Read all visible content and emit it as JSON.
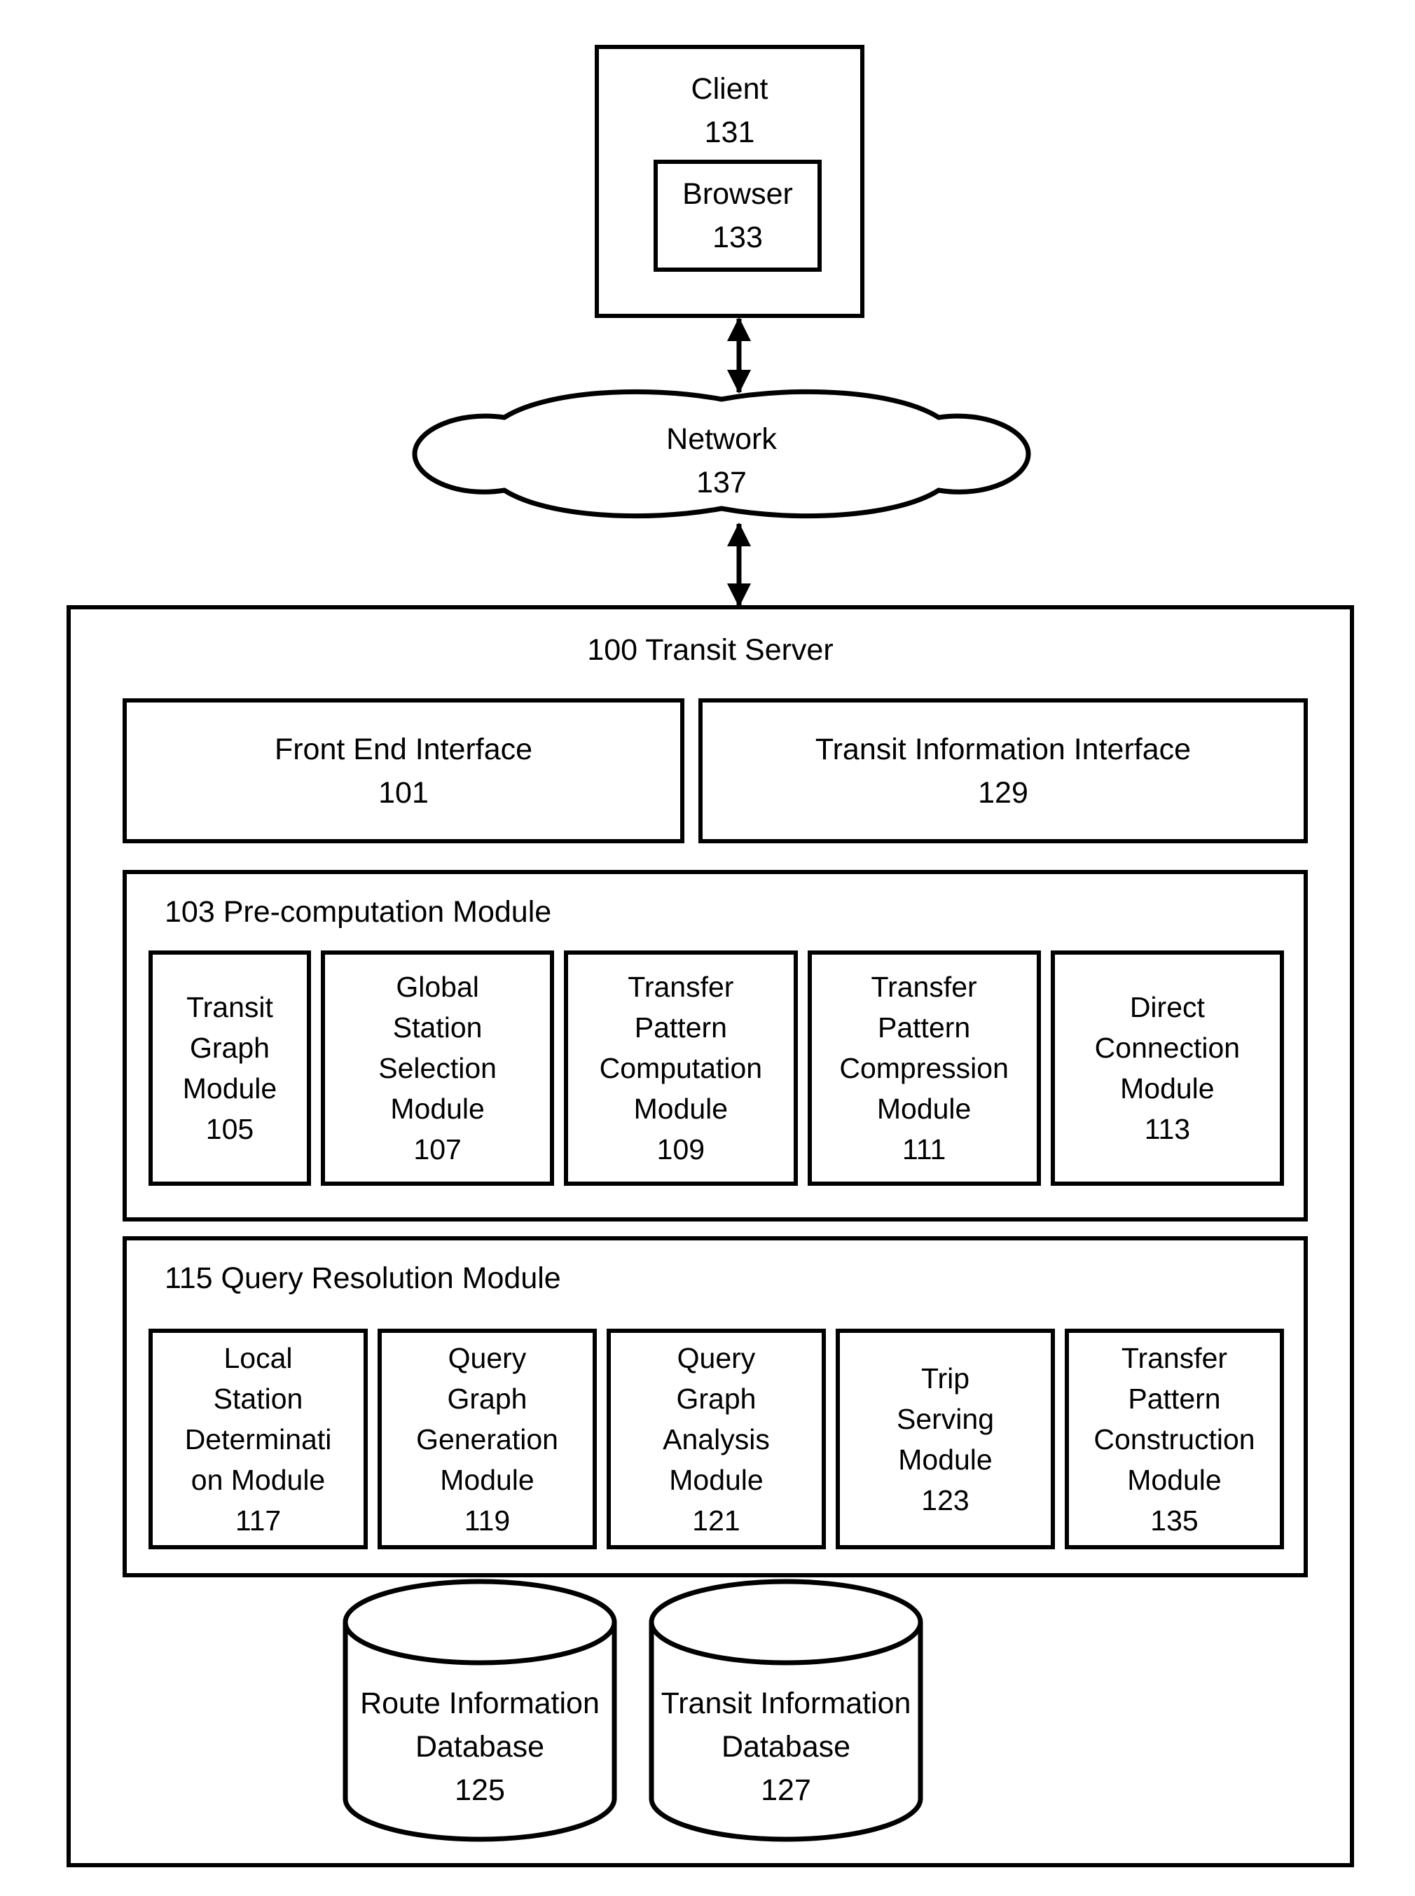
{
  "client": {
    "title": "Client\n131",
    "browser": {
      "title": "Browser\n133"
    }
  },
  "network": {
    "label": "Network\n137"
  },
  "arrows": {
    "client_to_network": "bidirectional-arrow",
    "network_to_server": "bidirectional-arrow"
  },
  "server": {
    "title": "100 Transit Server",
    "interfaces": [
      {
        "label": "Front End Interface\n101"
      },
      {
        "label": "Transit Information Interface\n129"
      }
    ],
    "precomputation": {
      "title": "103 Pre-computation Module",
      "modules": [
        {
          "label": "Transit\nGraph\nModule\n105"
        },
        {
          "label": "Global\nStation\nSelection\nModule\n107"
        },
        {
          "label": "Transfer\nPattern\nComputation\nModule\n109"
        },
        {
          "label": "Transfer\nPattern\nCompression\nModule\n111"
        },
        {
          "label": "Direct\nConnection\nModule\n113"
        }
      ]
    },
    "query_resolution": {
      "title": "115 Query Resolution Module",
      "modules": [
        {
          "label": "Local\nStation\nDeterminati\non Module\n117"
        },
        {
          "label": "Query\nGraph\nGeneration\nModule\n119"
        },
        {
          "label": "Query\nGraph\nAnalysis\nModule\n121"
        },
        {
          "label": "Trip\nServing\nModule\n123"
        },
        {
          "label": "Transfer\nPattern\nConstruction\nModule\n135"
        }
      ]
    },
    "databases": [
      {
        "label": "Route Information\nDatabase\n125"
      },
      {
        "label": "Transit Information\nDatabase\n127"
      }
    ]
  },
  "colors": {
    "stroke": "#000000",
    "fill": "#ffffff"
  }
}
